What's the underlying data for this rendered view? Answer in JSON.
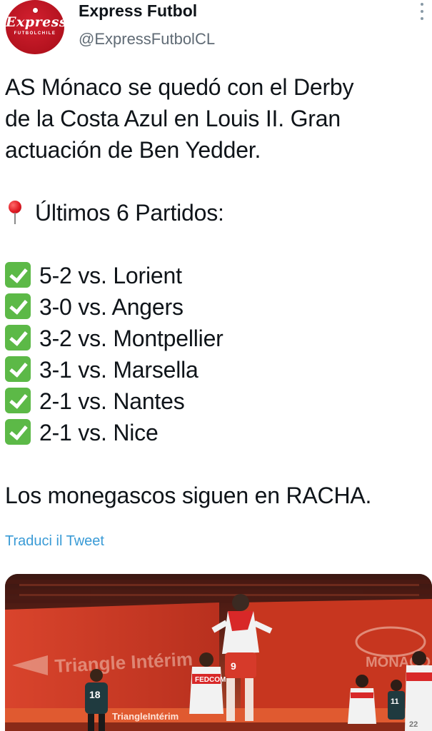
{
  "account": {
    "display_name": "Express Futbol",
    "handle": "@ExpressFutbolCL",
    "avatar_logo": "Express",
    "avatar_sub": "FUTBOLCHILE"
  },
  "tweet": {
    "lines_intro": [
      "AS Mónaco se quedó con el Derby",
      "de la Costa Azul en Louis II. Gran",
      "actuación de Ben Yedder."
    ],
    "section_title": "Últimos 6 Partidos:",
    "results": [
      "5-2 vs. Lorient",
      "3-0 vs. Angers",
      "3-2 vs. Montpellier",
      "3-1 vs. Marsella",
      "2-1 vs. Nantes",
      "2-1 vs. Nice"
    ],
    "closing": "Los monegascos siguen en RACHA.",
    "translate_label": "Traduci il Tweet"
  },
  "media": {
    "stand_text": "Triangle Intérim",
    "stand_text_2": "TriangleIntérim",
    "banner_text": "MONACO",
    "player_numbers": [
      "18",
      "9",
      "11",
      "22"
    ],
    "sponsor": "FEDCOM"
  },
  "colors": {
    "link": "#3a9bd6",
    "check": "#5cb947",
    "avatar_red": "#b3121e",
    "handle_grey": "#606b75"
  }
}
